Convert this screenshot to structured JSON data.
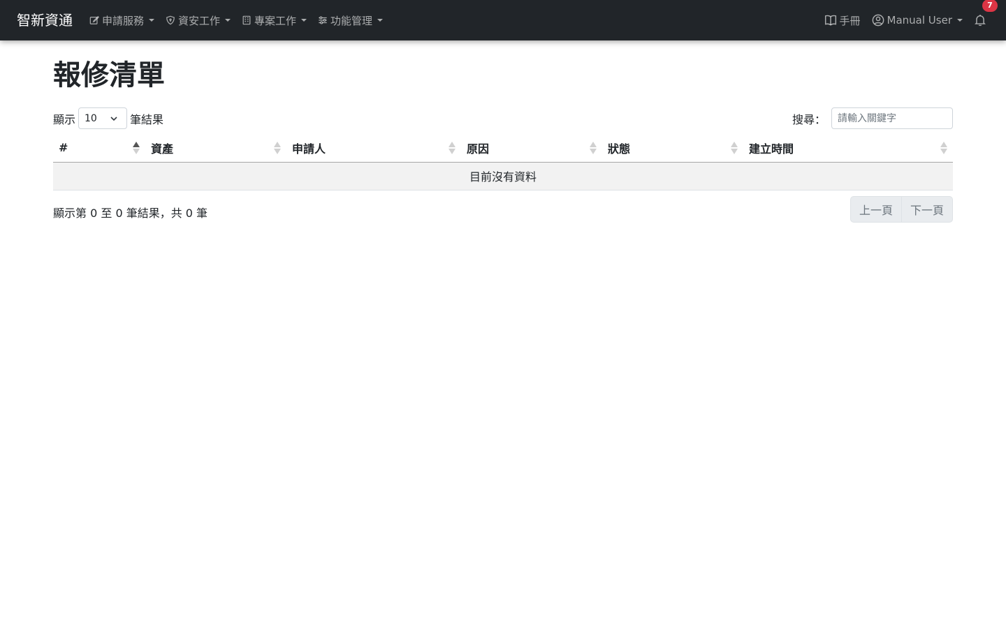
{
  "navbar": {
    "brand": "智新資通",
    "menus": [
      {
        "label": "申請服務",
        "icon": "pencil-square-icon"
      },
      {
        "label": "資安工作",
        "icon": "shield-icon"
      },
      {
        "label": "專案工作",
        "icon": "building-icon"
      },
      {
        "label": "功能管理",
        "icon": "sliders-icon"
      }
    ],
    "manual_label": "手冊",
    "user_label": "Manual User",
    "notification_count": "7"
  },
  "page": {
    "title": "報修清單"
  },
  "table_controls": {
    "show_prefix": "顯示",
    "page_length": "10",
    "show_suffix": "筆結果",
    "search_label": "搜尋：",
    "search_placeholder": "請輸入關鍵字"
  },
  "table": {
    "columns": [
      "#",
      "資產",
      "申請人",
      "原因",
      "狀態",
      "建立時間"
    ],
    "empty_message": "目前沒有資料"
  },
  "footer": {
    "info": "顯示第 0 至 0 筆結果，共 0 筆",
    "prev_label": "上一頁",
    "next_label": "下一頁"
  }
}
